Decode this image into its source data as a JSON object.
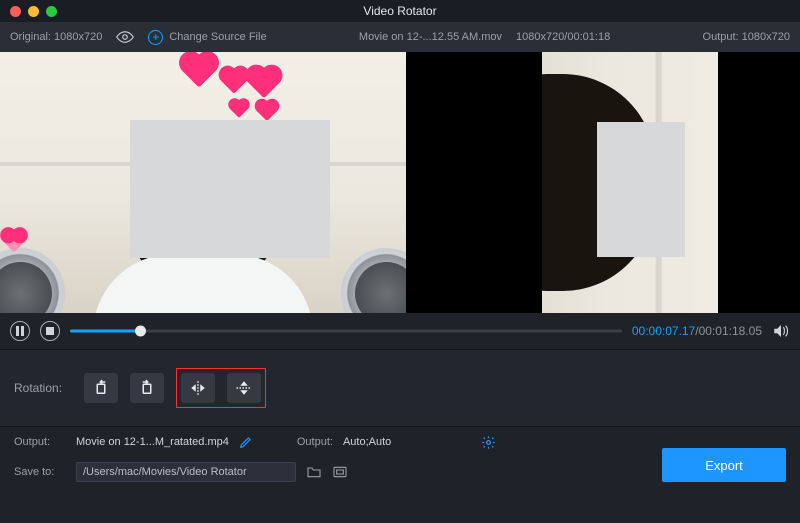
{
  "titlebar": {
    "title": "Video Rotator"
  },
  "infobar": {
    "original_label": "Original: 1080x720",
    "change_source": "Change Source File",
    "filename": "Movie on 12-...12.55 AM.mov",
    "dims_time": "1080x720/00:01:18",
    "output_label": "Output: 1080x720"
  },
  "player": {
    "current": "00:00:07.17",
    "total": "/00:01:18.05"
  },
  "rotation": {
    "label": "Rotation:"
  },
  "outputrow": {
    "label": "Output:",
    "filename": "Movie on 12-1...M_ratated.mp4",
    "label2": "Output:",
    "auto": "Auto;Auto"
  },
  "saverow": {
    "label": "Save to:",
    "path": "/Users/mac/Movies/Video Rotator"
  },
  "export": {
    "label": "Export"
  }
}
